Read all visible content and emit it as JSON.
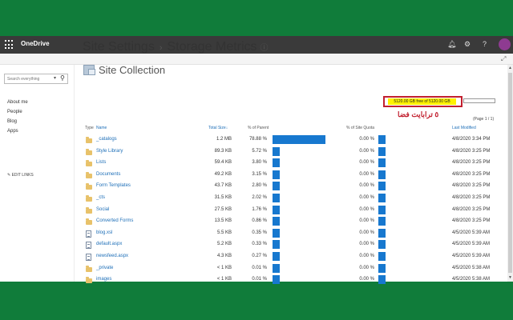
{
  "app": {
    "name": "OneDrive"
  },
  "header_icons": [
    "bell-icon",
    "gear-icon",
    "help-icon"
  ],
  "search": {
    "placeholder": "Search everything"
  },
  "nav": [
    "About me",
    "People",
    "Blog",
    "Apps"
  ],
  "edit_links": "EDIT LINKS",
  "page": {
    "title_part1": "Site Settings",
    "separator": "›",
    "title_part2": "Storage Metrics",
    "info_glyph": "ⓘ"
  },
  "section_title": "Site Collection",
  "quota": {
    "text": "5120.00 GB free of 5120.00 GB",
    "used_fraction": 0
  },
  "annotation": "٥ ترابایت فضا",
  "page_indicator": "(Page 1 / 1)",
  "columns": {
    "type": "Type",
    "name": "Name",
    "total_size": "Total Size",
    "pct_parent": "% of Parent",
    "pct_quota": "% of Site Quota",
    "last_modified": "Last Modified"
  },
  "rows": [
    {
      "kind": "folder",
      "name": "_catalogs",
      "size": "1.2 MB",
      "pct_parent": "78.88 %",
      "parent_value": 78.88,
      "pct_quota": "0.00 %",
      "date": "4/8/2020 3:34 PM"
    },
    {
      "kind": "folder",
      "name": "Style Library",
      "size": "89.3 KB",
      "pct_parent": "5.72 %",
      "parent_value": 5.72,
      "pct_quota": "0.00 %",
      "date": "4/8/2020 3:25 PM"
    },
    {
      "kind": "folder",
      "name": "Lists",
      "size": "59.4 KB",
      "pct_parent": "3.80 %",
      "parent_value": 3.8,
      "pct_quota": "0.00 %",
      "date": "4/8/2020 3:25 PM"
    },
    {
      "kind": "folder",
      "name": "Documents",
      "size": "49.2 KB",
      "pct_parent": "3.15 %",
      "parent_value": 3.15,
      "pct_quota": "0.00 %",
      "date": "4/8/2020 3:25 PM"
    },
    {
      "kind": "folder",
      "name": "Form Templates",
      "size": "43.7 KB",
      "pct_parent": "2.80 %",
      "parent_value": 2.8,
      "pct_quota": "0.00 %",
      "date": "4/8/2020 3:25 PM"
    },
    {
      "kind": "folder",
      "name": "_cts",
      "size": "31.5 KB",
      "pct_parent": "2.02 %",
      "parent_value": 2.02,
      "pct_quota": "0.00 %",
      "date": "4/8/2020 3:25 PM"
    },
    {
      "kind": "folder",
      "name": "Social",
      "size": "27.5 KB",
      "pct_parent": "1.76 %",
      "parent_value": 1.76,
      "pct_quota": "0.00 %",
      "date": "4/8/2020 3:25 PM"
    },
    {
      "kind": "folder",
      "name": "Converted Forms",
      "size": "13.5 KB",
      "pct_parent": "0.86 %",
      "parent_value": 0.86,
      "pct_quota": "0.00 %",
      "date": "4/8/2020 3:25 PM"
    },
    {
      "kind": "file",
      "name": "blog.xsl",
      "size": "5.5 KB",
      "pct_parent": "0.35 %",
      "parent_value": 0.35,
      "pct_quota": "0.00 %",
      "date": "4/5/2020 5:39 AM"
    },
    {
      "kind": "file",
      "name": "default.aspx",
      "size": "5.2 KB",
      "pct_parent": "0.33 %",
      "parent_value": 0.33,
      "pct_quota": "0.00 %",
      "date": "4/5/2020 5:39 AM"
    },
    {
      "kind": "file",
      "name": "newsfeed.aspx",
      "size": "4.3 KB",
      "pct_parent": "0.27 %",
      "parent_value": 0.27,
      "pct_quota": "0.00 %",
      "date": "4/5/2020 5:39 AM"
    },
    {
      "kind": "folder",
      "name": "_private",
      "size": "< 1 KB",
      "pct_parent": "0.01 %",
      "parent_value": 0.01,
      "pct_quota": "0.00 %",
      "date": "4/5/2020 5:38 AM"
    },
    {
      "kind": "folder",
      "name": "images",
      "size": "< 1 KB",
      "pct_parent": "0.01 %",
      "parent_value": 0.01,
      "pct_quota": "0.00 %",
      "date": "4/5/2020 5:38 AM"
    }
  ]
}
